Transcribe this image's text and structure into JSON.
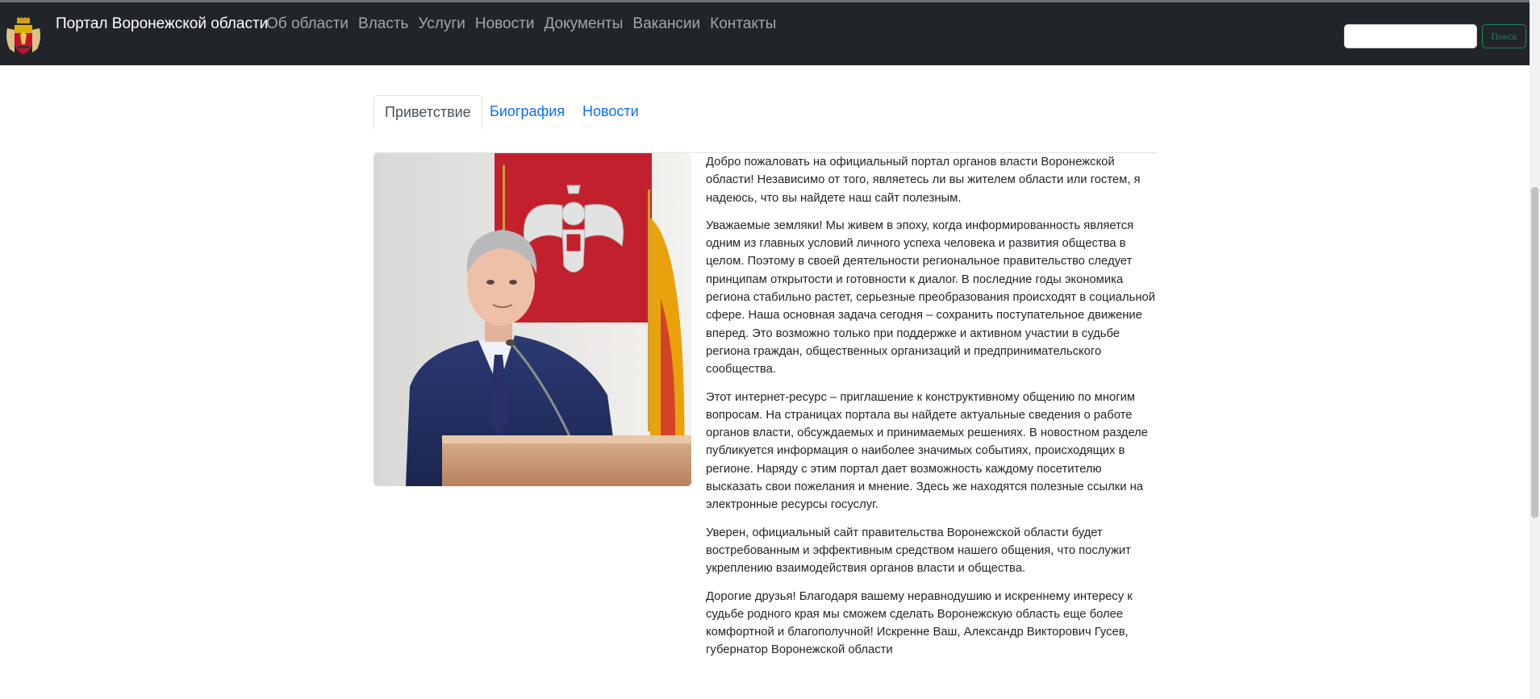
{
  "navbar": {
    "brand": "Портал Воронежской области",
    "links": [
      "Об области",
      "Власть",
      "Услуги",
      "Новости",
      "Документы",
      "Вакансии",
      "Контакты"
    ],
    "search_placeholder": "",
    "search_button": "Поиск"
  },
  "tabs": [
    {
      "label": "Приветствие",
      "active": true
    },
    {
      "label": "Биография",
      "active": false
    },
    {
      "label": "Новости",
      "active": false
    }
  ],
  "content": {
    "paragraphs": [
      "Добро пожаловать на официальный портал органов власти Воронежской области! Независимо от того, являетесь ли вы жителем области или гостем, я надеюсь, что вы найдете наш сайт полезным.",
      "Уважаемые земляки! Мы живем в эпоху, когда информированность является одним из главных условий личного успеха человека и развития общества в целом. Поэтому в своей деятельности региональное правительство следует принципам открытости и готовности к диалог. В последние годы экономика региона стабильно растет, серьезные преобразования происходят в социальной сфере. Наша основная задача сегодня – сохранить поступательное движение вперед. Это возможно только при поддержке и активном участии в судьбе региона граждан, общественных организаций и предпринимательского сообщества.",
      "Этот интернет-ресурс – приглашение к конструктивному общению по многим вопросам. На страницах портала вы найдете актуальные сведения о работе органов власти, обсуждаемых и принимаемых решениях. В новостном разделе публикуется информация о наиболее значимых событиях, происходящих в регионе. Наряду с этим портал дает возможность каждому посетителю высказать свои пожелания и мнение. Здесь же находятся полезные ссылки на электронные ресурсы госуслуг.",
      "Уверен, официальный сайт правительства Воронежской области будет востребованным и эффективным средством нашего общения, что послужит укреплению взаимодействия органов власти и общества.",
      "Дорогие друзья! Благодаря вашему неравнодушию и искреннему интересу к судьбе родного края мы сможем сделать Воронежскую область еще более комфортной и благополучной! Искренне Ваш, Александр Викторович Гусев, губернатор Воронежской области"
    ]
  },
  "colors": {
    "navbar_bg": "#212529",
    "link_active": "#0d6efd",
    "search_btn": "#198754"
  },
  "icons": {
    "logo": "coat-of-arms-icon"
  }
}
